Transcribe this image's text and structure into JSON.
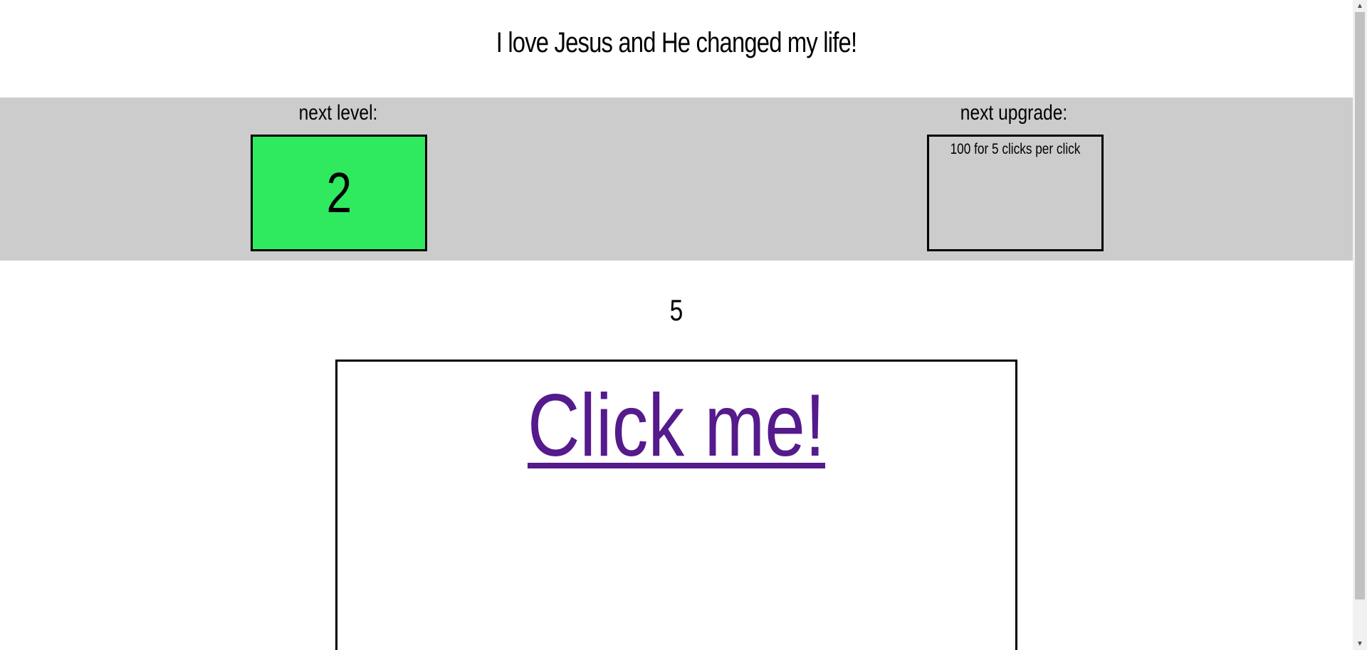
{
  "header": {
    "title": "I love Jesus and He changed my life!"
  },
  "level": {
    "label": "next level:",
    "value": "2",
    "box_color": "#2fea5f"
  },
  "upgrade": {
    "label": "next upgrade:",
    "text": "100 for 5 clicks per click"
  },
  "counter": {
    "value": "5"
  },
  "clicker": {
    "link_text": "Click me!",
    "link_color": "#551a8b"
  },
  "scrollbar": {
    "up_icon": "arrow-up-icon",
    "down_icon": "arrow-down-icon"
  }
}
